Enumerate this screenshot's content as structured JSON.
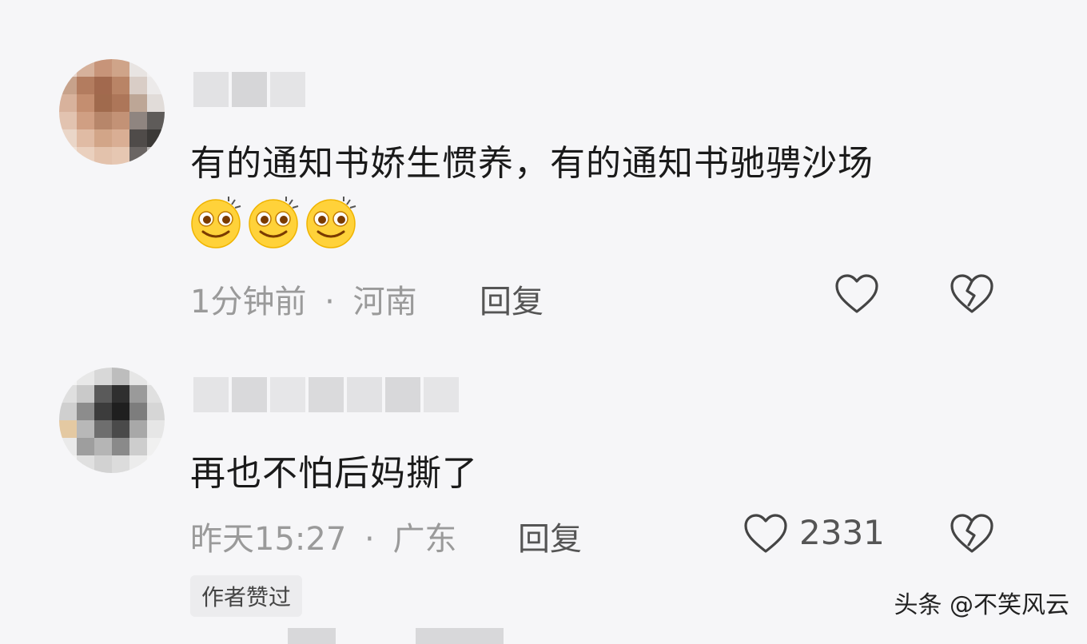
{
  "comments": [
    {
      "text": "有的通知书娇生惯养，有的通知书驰骋沙场",
      "time": "1分钟前",
      "sep": "·",
      "location": "河南",
      "reply_label": "回复",
      "emojis": [
        "smile-emoji",
        "smile-emoji",
        "smile-emoji"
      ]
    },
    {
      "text": "再也不怕后妈撕了",
      "time": "昨天15:27",
      "sep": "·",
      "location": "广东",
      "reply_label": "回复",
      "like_count": "2331",
      "badge": "作者赞过"
    }
  ],
  "watermark": "头条 @不笑风云",
  "colors": {
    "background": "#f6f6f8",
    "meta": "#9a9a9a",
    "icon": "#444444"
  }
}
